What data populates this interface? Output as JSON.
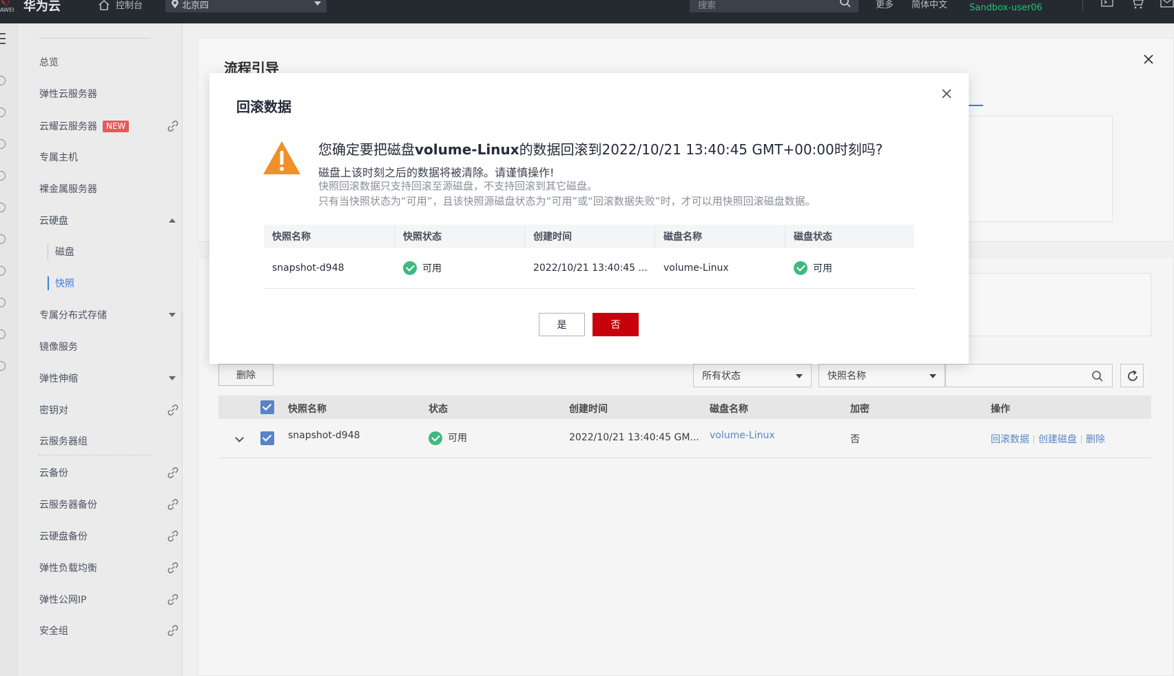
{
  "topbar": {
    "logo_sub": "AWEI",
    "brand": "华为云",
    "console": "控制台",
    "region": "北京四",
    "search_placeholder": "搜索",
    "more": "更多",
    "language": "简体中文",
    "user": "Sandbox-user06"
  },
  "sidebar": {
    "items": [
      {
        "label": "总览"
      },
      {
        "label": "弹性云服务器"
      },
      {
        "label": "云耀云服务器",
        "badge": "NEW"
      },
      {
        "label": "专属主机"
      },
      {
        "label": "裸金属服务器"
      },
      {
        "label": "云硬盘"
      },
      {
        "label": "磁盘"
      },
      {
        "label": "快照"
      },
      {
        "label": "专属分布式存储"
      },
      {
        "label": "镜像服务"
      },
      {
        "label": "弹性伸缩"
      },
      {
        "label": "密钥对"
      },
      {
        "label": "云服务器组"
      },
      {
        "label": "云备份"
      },
      {
        "label": "云服务器备份"
      },
      {
        "label": "云硬盘备份"
      },
      {
        "label": "弹性负载均衡"
      },
      {
        "label": "弹性公网IP"
      },
      {
        "label": "安全组"
      }
    ]
  },
  "guide": {
    "title": "流程引导"
  },
  "toolbar": {
    "delete": "删除",
    "status_filter": "所有状态",
    "name_filter": "快照名称"
  },
  "table": {
    "headers": [
      "快照名称",
      "状态",
      "创建时间",
      "磁盘名称",
      "加密",
      "操作"
    ],
    "rows": [
      {
        "name": "snapshot-d948",
        "status": "可用",
        "created": "2022/10/21 13:40:45 GM...",
        "disk": "volume-Linux",
        "encrypted": "否",
        "actions": [
          "回滚数据",
          "创建磁盘",
          "删除"
        ]
      }
    ]
  },
  "modal": {
    "title": "回滚数据",
    "question_prefix": "您确定要把磁盘",
    "question_disk": "volume-Linux",
    "question_suffix": "的数据回滚到2022/10/21 13:40:45 GMT+00:00时刻吗?",
    "line1": "磁盘上该时刻之后的数据将被清除。请谨慎操作!",
    "line2": "快照回滚数据只支持回滚至源磁盘，不支持回滚到其它磁盘。",
    "line3": "只有当快照状态为“可用”，且该快照源磁盘状态为“可用”或“回滚数据失败”时，才可以用快照回滚磁盘数据。",
    "table_headers": [
      "快照名称",
      "快照状态",
      "创建时间",
      "磁盘名称",
      "磁盘状态"
    ],
    "table_row": {
      "snapshot": "snapshot-d948",
      "snapshot_status": "可用",
      "created": "2022/10/21 13:40:45 ...",
      "disk": "volume-Linux",
      "disk_status": "可用"
    },
    "yes": "是",
    "no": "否"
  },
  "colors": {
    "primary_danger": "#c7000b",
    "link": "#5b86c8",
    "success": "#3fb980",
    "warning": "#f0902a",
    "user_green": "#20c27a"
  }
}
